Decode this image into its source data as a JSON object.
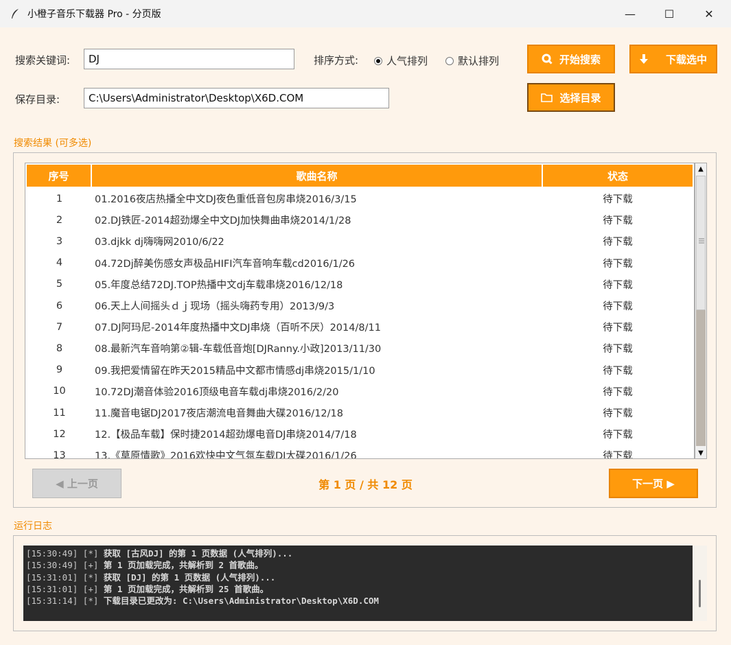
{
  "window": {
    "title": "小橙子音乐下载器 Pro - 分页版",
    "controls": {
      "minimize": "—",
      "maximize": "☐",
      "close": "✕"
    }
  },
  "search": {
    "keyword_label": "搜索关键词:",
    "keyword_value": "DJ",
    "sort_label": "排序方式:",
    "sort_options": [
      {
        "label": "人气排列",
        "selected": true
      },
      {
        "label": "默认排列",
        "selected": false
      }
    ],
    "search_button": "开始搜索",
    "download_button": "下载选中"
  },
  "save": {
    "label": "保存目录:",
    "path": "C:\\Users\\Administrator\\Desktop\\X6D.COM",
    "choose_button": "选择目录"
  },
  "results": {
    "group_title": "搜索结果 (可多选)",
    "columns": [
      "序号",
      "歌曲名称",
      "状态"
    ],
    "rows": [
      {
        "no": "1",
        "name": "01.2016夜店热播全中文DJ夜色重低音包房串烧2016/3/15",
        "status": "待下载"
      },
      {
        "no": "2",
        "name": "02.DJ铁匠-2014超劲爆全中文DJ加快舞曲串烧2014/1/28",
        "status": "待下载"
      },
      {
        "no": "3",
        "name": "03.djkk dj嗨嗨网2010/6/22",
        "status": "待下载"
      },
      {
        "no": "4",
        "name": "04.72Dj醉美伤感女声极品HIFI汽车音响车载cd2016/1/26",
        "status": "待下载"
      },
      {
        "no": "5",
        "name": "05.年度总结72DJ.TOP热播中文dj车载串烧2016/12/18",
        "status": "待下载"
      },
      {
        "no": "6",
        "name": "06.天上人间摇头ｄｊ现场（摇头嗨药专用）2013/9/3",
        "status": "待下载"
      },
      {
        "no": "7",
        "name": "07.DJ阿玛尼-2014年度热播中文DJ串烧（百听不厌）2014/8/11",
        "status": "待下载"
      },
      {
        "no": "8",
        "name": "08.最新汽车音响第②辑-车载低音炮[DJRanny.小政]2013/11/30",
        "status": "待下载"
      },
      {
        "no": "9",
        "name": "09.我把爱情留在昨天2015精品中文都市情感dj串烧2015/1/10",
        "status": "待下载"
      },
      {
        "no": "10",
        "name": "10.72DJ潮音体验2016顶级电音车载dj串烧2016/2/20",
        "status": "待下载"
      },
      {
        "no": "11",
        "name": "11.魔音电锯DJ2017夜店潮流电音舞曲大碟2016/12/18",
        "status": "待下载"
      },
      {
        "no": "12",
        "name": "12.【极品车载】保时捷2014超劲爆电音DJ串烧2014/7/18",
        "status": "待下载"
      },
      {
        "no": "13",
        "name": "13.《草原情歌》2016欢快中文气氛车载DJ大碟2016/1/26",
        "status": "待下载"
      }
    ]
  },
  "pagination": {
    "prev": "◀ 上一页",
    "info": "第 1 页 / 共 12 页",
    "next": "下一页 ▶"
  },
  "log": {
    "group_title": "运行日志",
    "lines": [
      {
        "time": "[15:30:49]",
        "tag": "[*]",
        "msg": "获取 [古风DJ] 的第 1 页数据 (人气排列)..."
      },
      {
        "time": "[15:30:49]",
        "tag": "[+]",
        "msg": "第 1 页加载完成，共解析到 2 首歌曲。"
      },
      {
        "time": "[15:31:01]",
        "tag": "[*]",
        "msg": "获取 [DJ] 的第 1 页数据 (人气排列)..."
      },
      {
        "time": "[15:31:01]",
        "tag": "[+]",
        "msg": "第 1 页加载完成，共解析到 25 首歌曲。"
      },
      {
        "time": "[15:31:14]",
        "tag": "[*]",
        "msg": "下载目录已更改为: C:\\Users\\Administrator\\Desktop\\X6D.COM"
      }
    ]
  },
  "colors": {
    "accent": "#ff9a0c",
    "accent_text": "#f08a00",
    "background": "#fdf4ea",
    "log_bg": "#2b2b2b"
  }
}
